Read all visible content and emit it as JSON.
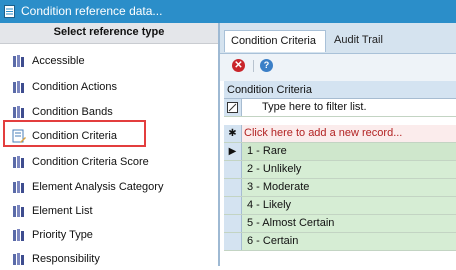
{
  "window": {
    "title": "Condition reference data..."
  },
  "left_panel": {
    "header": "Select reference type",
    "items": [
      {
        "label": "Accessible"
      },
      {
        "label": "Condition Actions"
      },
      {
        "label": "Condition Bands"
      },
      {
        "label": "Condition Criteria",
        "selected": true
      },
      {
        "label": "Condition Criteria Score"
      },
      {
        "label": "Element Analysis Category"
      },
      {
        "label": "Element List"
      },
      {
        "label": "Priority Type"
      },
      {
        "label": "Responsibility"
      }
    ]
  },
  "tabs": [
    {
      "label": "Condition Criteria",
      "active": true
    },
    {
      "label": "Audit Trail",
      "active": false
    }
  ],
  "grid": {
    "column_header": "Condition Criteria",
    "filter_placeholder": "Type here to filter list.",
    "add_record": "Click here to add a new record...",
    "rows": [
      {
        "value": "1 - Rare",
        "current": true
      },
      {
        "value": "2 - Unlikely"
      },
      {
        "value": "3 - Moderate"
      },
      {
        "value": "4 - Likely"
      },
      {
        "value": "5 - Almost Certain"
      },
      {
        "value": "6 - Certain"
      }
    ]
  },
  "icons": {
    "title_icon": "document-icon",
    "list_item_icon": "books-icon",
    "selected_item_icon": "criteria-edit-icon",
    "delete_icon": "delete-icon",
    "help_icon": "help-icon"
  },
  "colors": {
    "titlebar": "#2b8ec9",
    "selection_border": "#e33e3e",
    "row_background": "#d6edd4",
    "add_record_text": "#b22222"
  }
}
